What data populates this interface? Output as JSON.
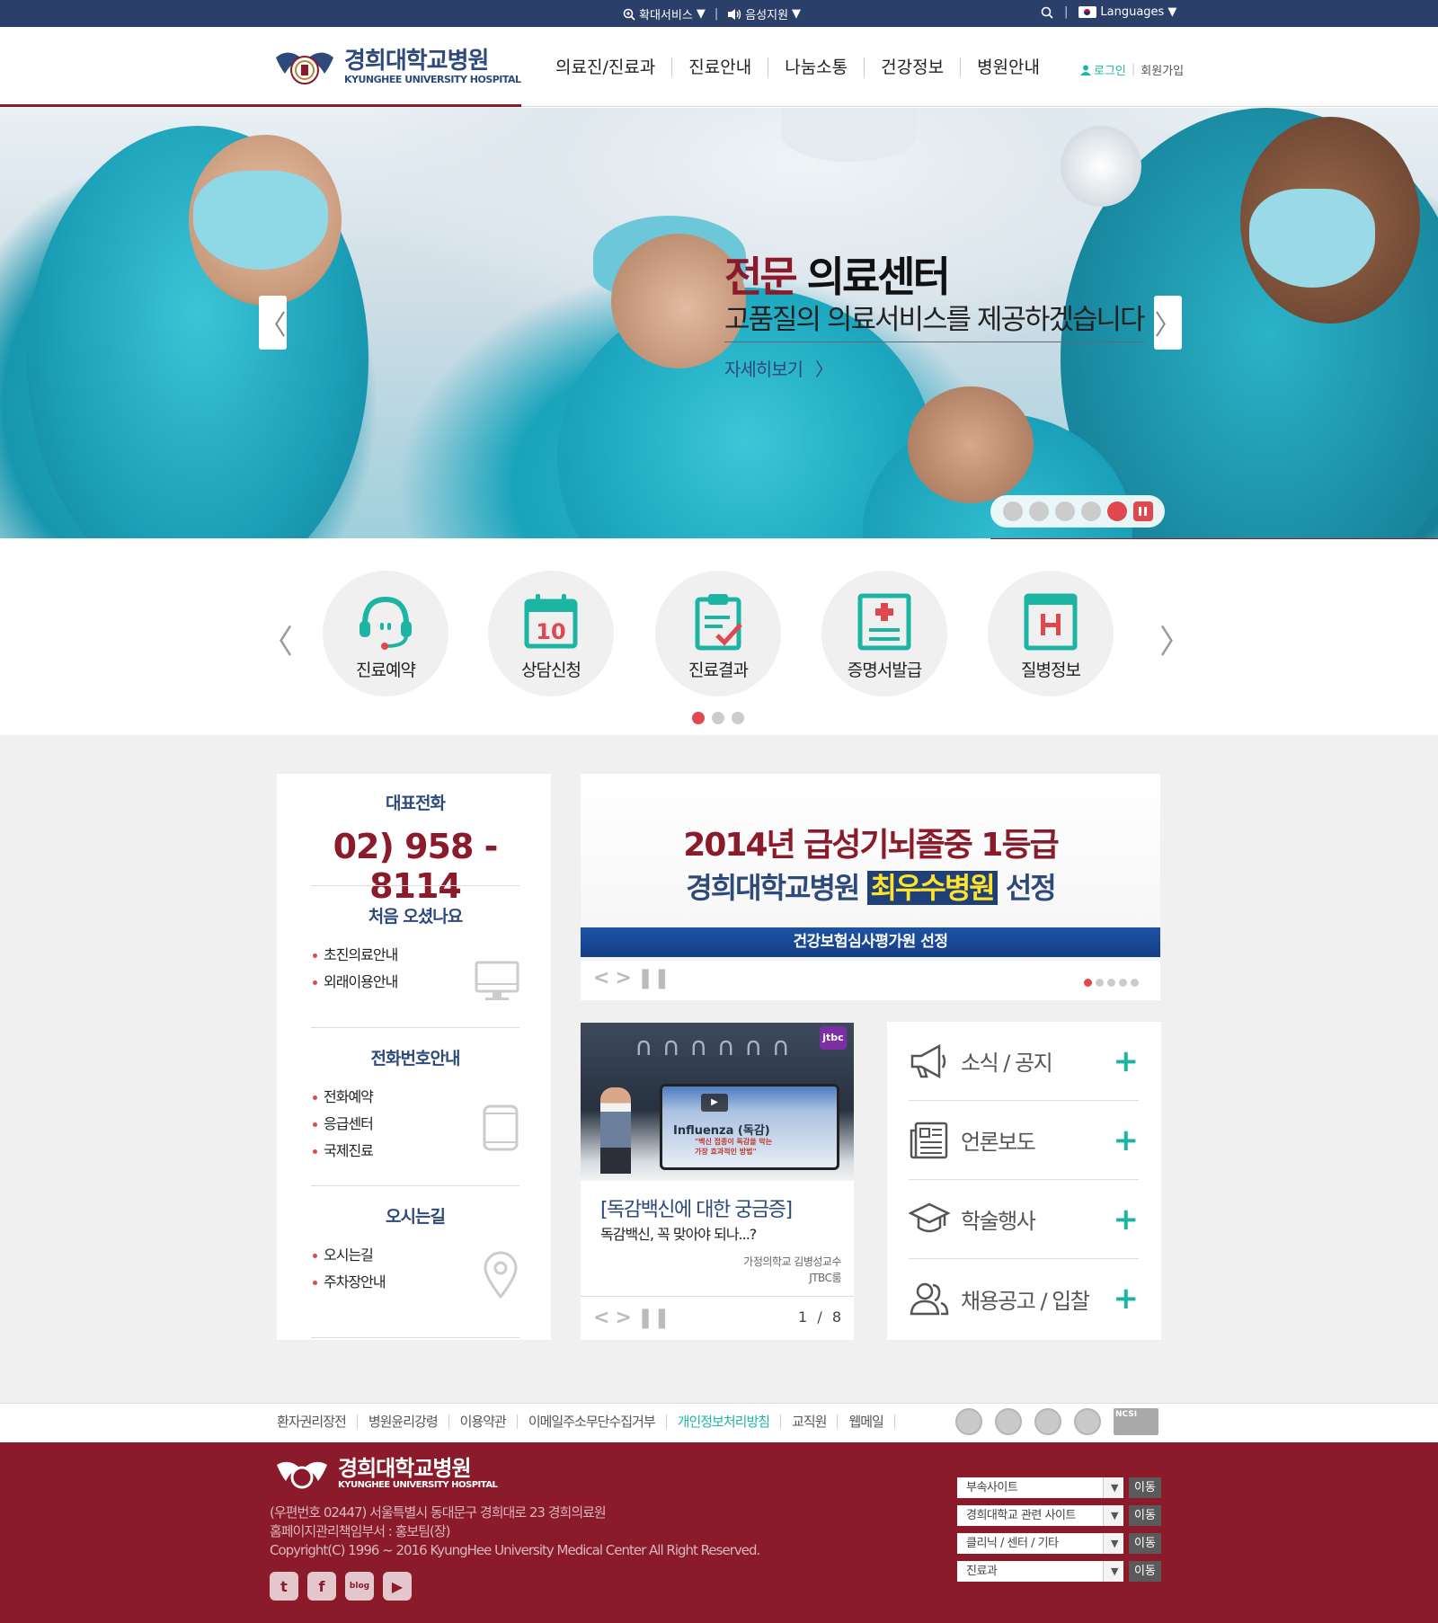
{
  "topbar": {
    "zoom": "확대서비스",
    "voice": "음성지원",
    "languages": "Languages"
  },
  "header": {
    "logo_ko": "경희대학교병원",
    "logo_en": "KYUNGHEE UNIVERSITY HOSPITAL",
    "nav": [
      "의료진/진료과",
      "진료안내",
      "나눔소통",
      "건강정보",
      "병원안내"
    ],
    "login": "로그인",
    "join": "회원가입"
  },
  "hero": {
    "title_accent": "전문",
    "title_rest": " 의료센터",
    "subtitle": "고품질의 의료서비스를 제공하겠습니다",
    "more": "자세히보기",
    "active_slide": 5,
    "slide_count": 5
  },
  "quick": {
    "items": [
      "진료예약",
      "상담신청",
      "진료결과",
      "증명서발급",
      "질병정보"
    ],
    "calendar_number": "10",
    "page_count": 3,
    "active_page": 1
  },
  "info": {
    "phone_title": "대표전화",
    "phone": "02) 958 - 8114",
    "first_title": "처음 오셨나요",
    "first_items": [
      "초진의료안내",
      "외래이용안내"
    ],
    "tel_title": "전화번호안내",
    "tel_items": [
      "전화예약",
      "응급센터",
      "국제진료"
    ],
    "way_title": "오시는길",
    "way_items": [
      "오시는길",
      "주차장안내"
    ]
  },
  "banner": {
    "line1": "2014년 급성기뇌졸중 1등급",
    "line2_a": "경희대학교병원 ",
    "line2_hl": "최우수병원",
    "line2_b": " 선정",
    "line3": "건강보험심사평가원 선정",
    "slide_count": 5,
    "active_slide": 1
  },
  "video": {
    "screen_title": "Influenza (독감)",
    "screen_sub1": "\"백신 접종이 독감을 막는",
    "screen_sub2": "가장 효과적인 방법\"",
    "channel": "jtbc",
    "title": "[독감백신에 대한 궁금증]",
    "subtitle": "독감백신, 꼭 맞아야 되나...?",
    "source1": "가정의학교 김병성교수",
    "source2": "JTBC룸",
    "page_current": "1",
    "page_sep": "/",
    "page_total": "8"
  },
  "board": {
    "items": [
      {
        "label": "소식 / 공지",
        "icon": "megaphone-icon"
      },
      {
        "label": "언론보도",
        "icon": "newspaper-icon"
      },
      {
        "label": "학술행사",
        "icon": "graduation-cap-icon"
      },
      {
        "label": "채용공고 / 입찰",
        "icon": "users-icon"
      }
    ]
  },
  "footer_links": {
    "items": [
      "환자권리장전",
      "병원윤리강령",
      "이용약관",
      "이메일주소무단수집거부",
      "개인정보처리방침",
      "교직원",
      "웹메일"
    ],
    "ncsi": "NCSI"
  },
  "footer": {
    "logo_ko": "경희대학교병원",
    "logo_en": "KYUNGHEE UNIVERSITY HOSPITAL",
    "address": "(우편번호 02447) 서울특별시 동대문구 경희대로 23 경희의료원",
    "manager": "홈페이지관리책임부서 : 홍보팀(장)",
    "copyright": "Copyright(C) 1996 ~ 2016 KyungHee University Medical Center All Right Reserved.",
    "sns_blog": "blog",
    "sites": [
      "부속사이트",
      "경희대학교 관련 사이트",
      "클리닉 / 센터 / 기타",
      "진료과"
    ],
    "go": "이동"
  },
  "colors": {
    "brand_navy": "#2b3f6b",
    "brand_red": "#8b1a2a",
    "accent_teal": "#1cb5a4",
    "dot_active": "#e0484f"
  }
}
